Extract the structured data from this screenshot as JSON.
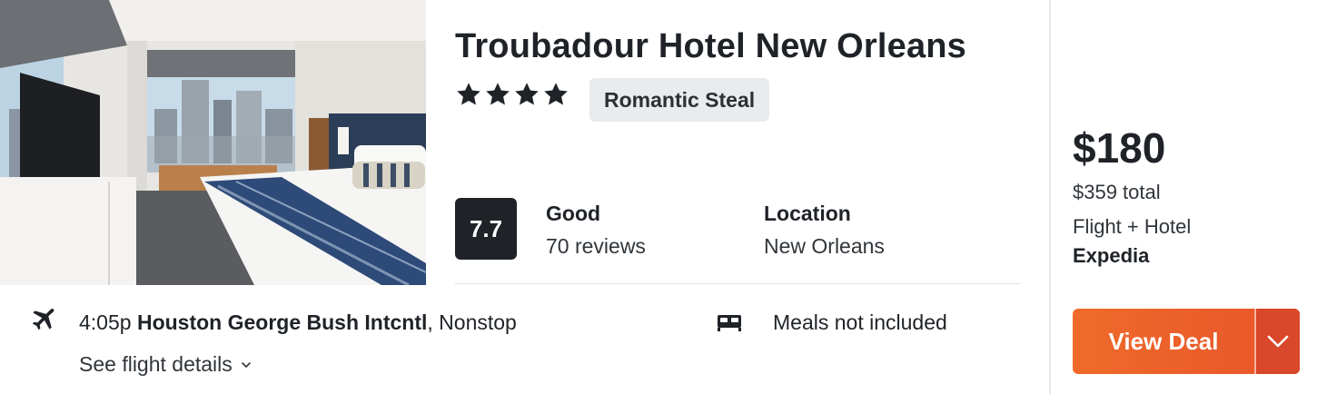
{
  "hotel": {
    "name": "Troubadour Hotel New Orleans",
    "stars": 4,
    "badge": "Romantic Steal",
    "score": "7.7",
    "rating_label": "Good",
    "reviews": "70 reviews",
    "location_label": "Location",
    "location": "New Orleans",
    "image_icon": "hotel-room-photo"
  },
  "flight": {
    "icon": "airplane-icon",
    "time": "4:05p",
    "airport": "Houston George Bush Intcntl",
    "stops": ", Nonstop",
    "details_link": "See flight details"
  },
  "amenities": {
    "icon": "bed-icon",
    "meals": "Meals not included"
  },
  "pricing": {
    "price": "$180",
    "total": "$359 total",
    "package": "Flight + Hotel",
    "provider": "Expedia",
    "cta": "View Deal"
  },
  "colors": {
    "accent": "#ec5f2a",
    "score_bg": "#1f2328",
    "badge_bg": "#e9ebee"
  }
}
